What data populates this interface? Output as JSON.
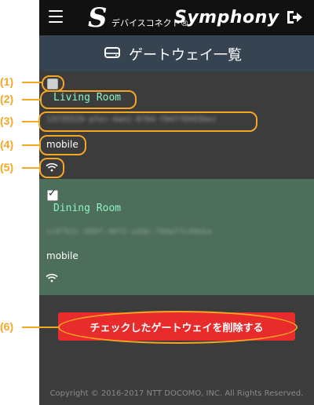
{
  "app": {
    "brand_mark": "S",
    "brand_small": "デバイスコネクト®",
    "brand_name": "Symphony"
  },
  "page": {
    "title": "ゲートウェイ一覧"
  },
  "gateways": [
    {
      "checked": false,
      "name": "Living Room",
      "id": "13f35529-afec-4ae1-8704-f04776955bec",
      "connection": "mobile"
    },
    {
      "checked": true,
      "name": "Dining Room",
      "id": "cc07b2c-099f-40f2-a3de-799af7c49eba",
      "connection": "mobile"
    }
  ],
  "actions": {
    "delete_label": "チェックしたゲートウェイを削除する"
  },
  "footer": {
    "copyright": "Copyright © 2016-2017 NTT DOCOMO, INC. All Rights Reserved."
  },
  "annotations": {
    "m1": "(1)",
    "m2": "(2)",
    "m3": "(3)",
    "m4": "(4)",
    "m5": "(5)",
    "m6": "(6)"
  },
  "colors": {
    "accent": "#f5a623",
    "danger": "#e82b2b",
    "selected_row": "#4c6e5a",
    "room_name": "#8ef5c0"
  }
}
